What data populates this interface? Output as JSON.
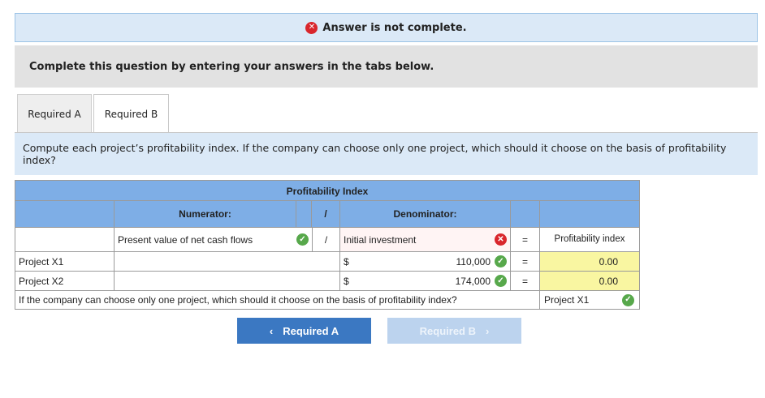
{
  "banner": {
    "status_icon": "x-circle-icon",
    "text": "Answer is not complete."
  },
  "instruction": "Complete this question by entering your answers in the tabs below.",
  "tabs": [
    {
      "label": "Required A",
      "active": false
    },
    {
      "label": "Required B",
      "active": true
    }
  ],
  "question": "Compute each project’s profitability index. If the company can choose only one project, which should it choose on the basis of profitability index?",
  "table": {
    "title": "Profitability Index",
    "numerator_label": "Numerator:",
    "divide_symbol": "/",
    "denominator_label": "Denominator:",
    "numerator_value": "Present value of net cash flows",
    "denominator_value": "Initial investment",
    "equals_symbol": "=",
    "result_header": "Profitability index",
    "rows": [
      {
        "label": "Project X1",
        "currency": "$",
        "denominator": "110,000",
        "index": "0.00"
      },
      {
        "label": "Project X2",
        "currency": "$",
        "denominator": "174,000",
        "index": "0.00"
      }
    ],
    "choice_question": "If the company can choose only one project, which should it choose on the basis of profitability index?",
    "choice_answer": "Project X1"
  },
  "nav": {
    "prev_label": "Required A",
    "next_label": "Required B"
  },
  "colors": {
    "header_blue": "#7eaee6",
    "answer_yellow": "#f9f6a1",
    "correct_green": "#57a84b",
    "incorrect_red": "#d9262c"
  }
}
